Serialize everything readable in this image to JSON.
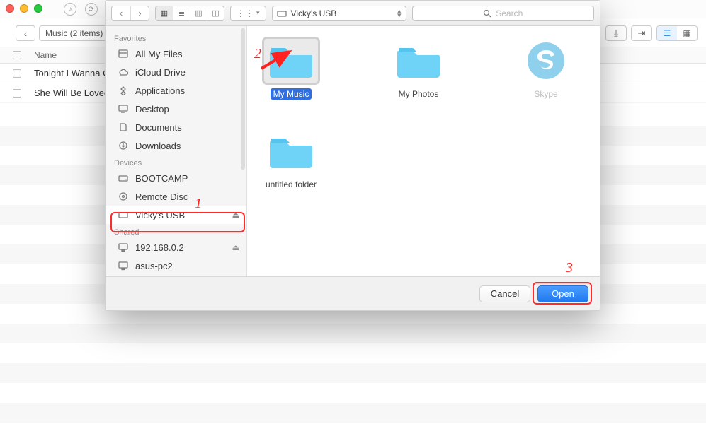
{
  "bg": {
    "breadcrumb": "Music (2 items)",
    "header_name": "Name",
    "rows": [
      "Tonight I Wanna C",
      "She Will Be Loved"
    ]
  },
  "dialog": {
    "location": "Vicky's USB",
    "search_placeholder": "Search",
    "sidebar": {
      "sections": [
        {
          "title": "Favorites",
          "items": [
            {
              "label": "All My Files",
              "icon": "all-files"
            },
            {
              "label": "iCloud Drive",
              "icon": "icloud"
            },
            {
              "label": "Applications",
              "icon": "apps"
            },
            {
              "label": "Desktop",
              "icon": "desktop"
            },
            {
              "label": "Documents",
              "icon": "documents"
            },
            {
              "label": "Downloads",
              "icon": "downloads"
            }
          ]
        },
        {
          "title": "Devices",
          "items": [
            {
              "label": "BOOTCAMP",
              "icon": "hdd"
            },
            {
              "label": "Remote Disc",
              "icon": "disc"
            },
            {
              "label": "Vicky's USB",
              "icon": "usb",
              "selected": true,
              "eject": true
            }
          ]
        },
        {
          "title": "Shared",
          "items": [
            {
              "label": "192.168.0.2",
              "icon": "monitor",
              "eject": true
            },
            {
              "label": "asus-pc2",
              "icon": "monitor"
            }
          ]
        }
      ]
    },
    "items": [
      {
        "label": "My Music",
        "kind": "folder",
        "selected": true
      },
      {
        "label": "My Photos",
        "kind": "folder"
      },
      {
        "label": "Skype",
        "kind": "skype",
        "dimmed": true
      },
      {
        "label": "untitled folder",
        "kind": "folder"
      }
    ],
    "footer": {
      "cancel": "Cancel",
      "open": "Open"
    }
  },
  "annotations": {
    "n1": "1",
    "n2": "2",
    "n3": "3"
  }
}
